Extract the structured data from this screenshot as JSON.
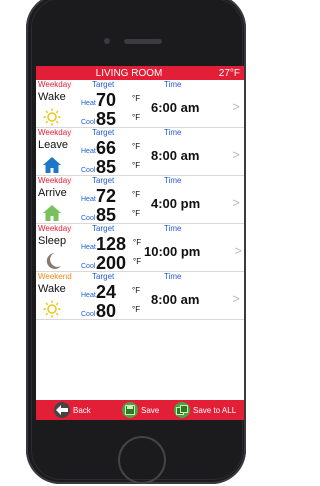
{
  "header": {
    "title": "LIVING ROOM",
    "temp": "27°F"
  },
  "labels": {
    "target": "Target",
    "time": "Time",
    "heat": "Heat",
    "cool": "Cool",
    "unit": "°F",
    "chevron": ">"
  },
  "entries": [
    {
      "period": "Weekday",
      "name": "Wake",
      "heat": "70",
      "cool": "85",
      "time": "6:00 am",
      "icon": "sun-icon"
    },
    {
      "period": "Weekday",
      "name": "Leave",
      "heat": "66",
      "cool": "85",
      "time": "8:00 am",
      "icon": "home-icon"
    },
    {
      "period": "Weekday",
      "name": "Arrive",
      "heat": "72",
      "cool": "85",
      "time": "4:00 pm",
      "icon": "home-arrive-icon"
    },
    {
      "period": "Weekday",
      "name": "Sleep",
      "heat": "128",
      "cool": "200",
      "time": "10:00 pm",
      "icon": "moon-icon"
    },
    {
      "period": "Weekend",
      "name": "Wake",
      "heat": "24",
      "cool": "80",
      "time": "8:00 am",
      "icon": "sun-icon"
    }
  ],
  "footer": {
    "back": "Back",
    "save": "Save",
    "save_all": "Save to ALL"
  },
  "colors": {
    "accent": "#e21f37",
    "weekend": "#f08a18",
    "link": "#1f5fd6"
  }
}
